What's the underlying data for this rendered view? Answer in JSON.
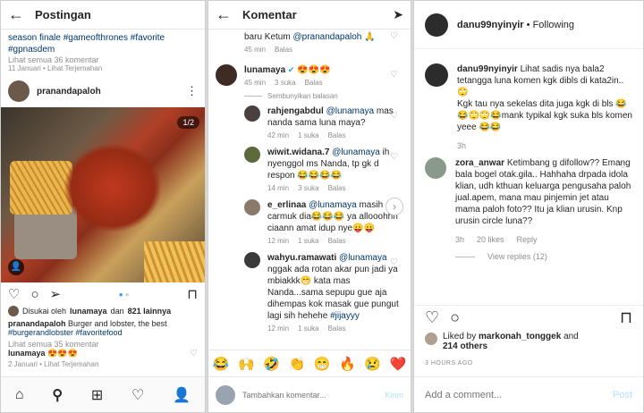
{
  "p1": {
    "title": "Postingan",
    "top_caption": "season finale #gameofthrones #favorite #gpnasdem",
    "top_view_all": "Lihat semua 36 komentar",
    "top_date": "11 Januari",
    "top_translate": "Lihat Terjemahan",
    "post_user": "pranandapaloh",
    "photo_counter": "1/2",
    "liked_prefix": "Disukai oleh",
    "liked_user": "lunamaya",
    "liked_and": "dan",
    "liked_count": "821 lainnya",
    "caption_user": "pranandapaloh",
    "caption_text": "Burger and lobster, the best",
    "caption_tags": "#burgerandlobster #favoritefood",
    "view_all": "Lihat semua 35 komentar",
    "comment_user": "lunamaya",
    "comment_text": "😍😍😍",
    "date": "2 Januari",
    "translate": "Lihat Terjemahan"
  },
  "p2": {
    "title": "Komentar",
    "c0_text": "baru Ketum",
    "c0_mention": "@pranandapaloh",
    "c0_emoji": "🙏",
    "c0_time": "45 min",
    "c0_reply": "Balas",
    "luna": {
      "user": "lunamaya",
      "verified": "✔",
      "text": "😍😍😍",
      "time": "45 min",
      "likes": "3 suka",
      "reply": "Balas"
    },
    "hide_replies": "Sembunyikan balasan",
    "replies": [
      {
        "user": "rahjengabdul",
        "mention": "@lunamaya",
        "text": "mas nanda sama luna maya?",
        "time": "42 min",
        "likes": "1 suka",
        "reply": "Balas"
      },
      {
        "user": "wiwit.widana.7",
        "mention": "@lunamaya",
        "text": "ih nyenggol ms Nanda, tp gk d respon 😂😂😂😂",
        "time": "14 min",
        "likes": "3 suka",
        "reply": "Balas"
      },
      {
        "user": "e_erlinaa",
        "mention": "@lunamaya",
        "text": "masih carmuk dia😂😂😂 ya allooohhh ciaann amat idup nye😛😛",
        "time": "12 min",
        "likes": "1 suka",
        "reply": "Balas"
      },
      {
        "user": "wahyu.ramawati",
        "mention": "@lunamaya",
        "text": "nggak ada rotan akar pun jadi ya mbiakkk😁 kata mas Nanda...sama sepupu gue aja dihempas kok masak gue pungut lagi sih hehehe",
        "tag": "#jijayyy",
        "time": "12 min",
        "likes": "1 suka",
        "reply": "Balas"
      }
    ],
    "emojis": [
      "😂",
      "🙌",
      "🤣",
      "👏",
      "😁",
      "🔥",
      "😢",
      "❤️"
    ],
    "input_placeholder": "Tambahkan komentar...",
    "send": "Kirim"
  },
  "p3": {
    "user": "danu99nyinyir",
    "sep": "•",
    "follow": "Following",
    "c1_user": "danu99nyinyir",
    "c1_text": "Lihat sadis nya bala2 tetangga luna komen kgk dibls di kata2in.. 🙄",
    "c1_text2": "Kgk tau nya sekelas dita juga kgk di bls 😂😂🙄🙄😂mank typikal kgk suka bls komen yeee 😂😂",
    "c1_time": "3h",
    "c2_user": "zora_anwar",
    "c2_text": "Ketimbang g difollow?? Emang bala bogel otak.gila.. Hahhaha drpada idola klian, udh kthuan keluarga pengusaha paloh jual.apem, mana mau pinjemin jet atau mama paloh foto?? Itu ja klian urusin. Knp urusin circle luna??",
    "c2_time": "3h",
    "c2_likes": "20 likes",
    "c2_reply": "Reply",
    "view_replies": "View replies (12)",
    "liked_prefix": "Liked by",
    "liked_user": "markonah_tonggek",
    "liked_and": "and",
    "liked_count": "214 others",
    "time": "3 HOURS AGO",
    "add_placeholder": "Add a comment...",
    "post": "Post"
  }
}
